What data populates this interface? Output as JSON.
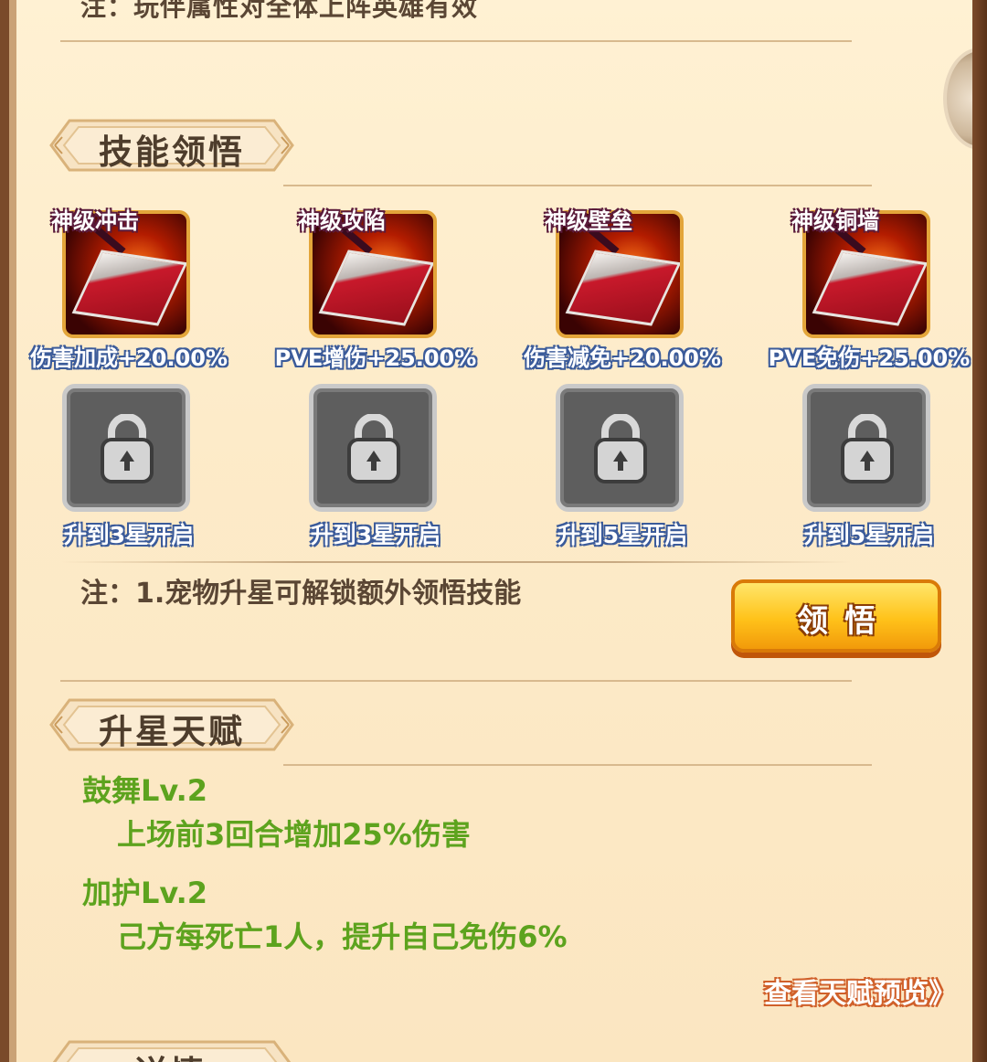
{
  "top_note": "注：玩伴属性对全体上阵英雄有效",
  "skill_section": {
    "title": "技能领悟",
    "skills": [
      {
        "name": "神级冲击",
        "effect": "伤害加成+20.00%"
      },
      {
        "name": "神级攻陷",
        "effect": "PVE增伤+25.00%"
      },
      {
        "name": "神级壁垒",
        "effect": "伤害减免+20.00%"
      },
      {
        "name": "神级铜墙",
        "effect": "PVE免伤+25.00%"
      }
    ],
    "locked_slots": [
      {
        "label": "升到3星开启",
        "icon": "padlock-icon"
      },
      {
        "label": "升到3星开启",
        "icon": "padlock-icon"
      },
      {
        "label": "升到5星开启",
        "icon": "padlock-icon"
      },
      {
        "label": "升到5星开启",
        "icon": "padlock-icon"
      }
    ],
    "note": "注：1.宠物升星可解锁额外领悟技能",
    "comprehend_button": "领悟"
  },
  "star_talent_section": {
    "title": "升星天赋",
    "talents": [
      {
        "name": "鼓舞Lv.2",
        "desc": "上场前3回合增加25%伤害"
      },
      {
        "name": "加护Lv.2",
        "desc": "己方每死亡1人，提升自己免伤6%"
      }
    ],
    "preview_link": "查看天赋预览》"
  },
  "next_section": {
    "title": "详情"
  },
  "colors": {
    "panel_bg": "#fdebc9",
    "talent_green": "#5da31e",
    "button_gold": "#ffc21a",
    "frame_brown": "#7a4a2a"
  }
}
